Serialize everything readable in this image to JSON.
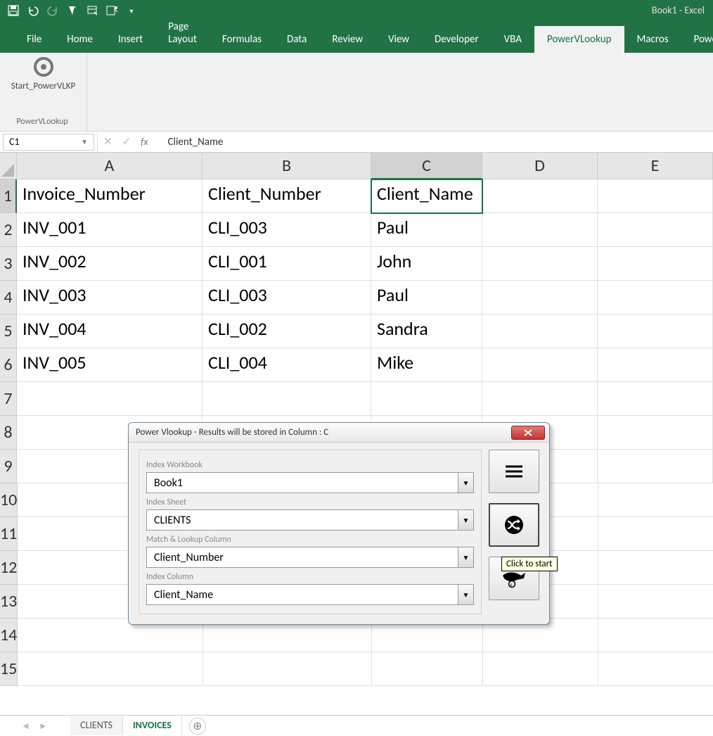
{
  "title": "Book1  -  Excel",
  "qat_icons": [
    "save",
    "undo",
    "redo",
    "touch-mode",
    "quick-print",
    "spelling",
    "customize"
  ],
  "tabs": [
    "File",
    "Home",
    "Insert",
    "Page Layout",
    "Formulas",
    "Data",
    "Review",
    "View",
    "Developer",
    "VBA",
    "PowerVLookup",
    "Macros",
    "Powe"
  ],
  "active_tab": "PowerVLookup",
  "ribbon_button": "Start_PowerVLKP",
  "ribbon_group": "PowerVLookup",
  "name_box": "C1",
  "formula_value": "Client_Name",
  "columns": [
    "A",
    "B",
    "C",
    "D",
    "E"
  ],
  "selected_col": "C",
  "selected_row": 1,
  "rows": [
    {
      "n": 1,
      "A": "Invoice_Number",
      "B": "Client_Number",
      "C": "Client_Name",
      "D": "",
      "E": ""
    },
    {
      "n": 2,
      "A": "INV_001",
      "B": "CLI_003",
      "C": "Paul",
      "D": "",
      "E": ""
    },
    {
      "n": 3,
      "A": "INV_002",
      "B": "CLI_001",
      "C": "John",
      "D": "",
      "E": ""
    },
    {
      "n": 4,
      "A": "INV_003",
      "B": "CLI_003",
      "C": "Paul",
      "D": "",
      "E": ""
    },
    {
      "n": 5,
      "A": "INV_004",
      "B": "CLI_002",
      "C": "Sandra",
      "D": "",
      "E": ""
    },
    {
      "n": 6,
      "A": "INV_005",
      "B": "CLI_004",
      "C": "Mike",
      "D": "",
      "E": ""
    },
    {
      "n": 7,
      "A": "",
      "B": "",
      "C": "",
      "D": "",
      "E": ""
    },
    {
      "n": 8,
      "A": "",
      "B": "",
      "C": "",
      "D": "",
      "E": ""
    },
    {
      "n": 9,
      "A": "",
      "B": "",
      "C": "",
      "D": "",
      "E": ""
    },
    {
      "n": 10,
      "A": "",
      "B": "",
      "C": "",
      "D": "",
      "E": ""
    },
    {
      "n": 11,
      "A": "",
      "B": "",
      "C": "",
      "D": "",
      "E": ""
    },
    {
      "n": 12,
      "A": "",
      "B": "",
      "C": "",
      "D": "",
      "E": ""
    },
    {
      "n": 13,
      "A": "",
      "B": "",
      "C": "",
      "D": "",
      "E": ""
    },
    {
      "n": 14,
      "A": "",
      "B": "",
      "C": "",
      "D": "",
      "E": ""
    },
    {
      "n": 15,
      "A": "",
      "B": "",
      "C": "",
      "D": "",
      "E": ""
    }
  ],
  "sheet_tabs": [
    "CLIENTS",
    "INVOICES"
  ],
  "active_sheet": "INVOICES",
  "dialog": {
    "title": "Power Vlookup - Results will be stored in Column : C",
    "fields": [
      {
        "label": "Index Workbook",
        "value": "Book1"
      },
      {
        "label": "Index Sheet",
        "value": "CLIENTS"
      },
      {
        "label": "Match & Lookup Column",
        "value": "Client_Number"
      },
      {
        "label": "Index Column",
        "value": "Client_Name"
      }
    ],
    "tooltip": "Click to start"
  }
}
